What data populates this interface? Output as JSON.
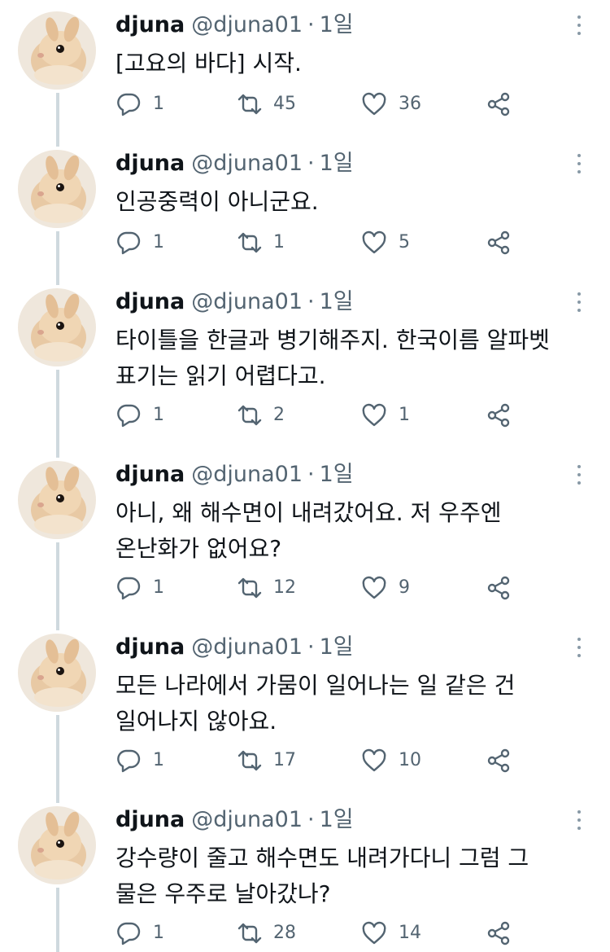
{
  "tweets": [
    {
      "name": "djuna",
      "handle": "@djuna01",
      "separator": "·",
      "time": "1일",
      "text": "[고요의 바다] 시작.",
      "replies": "1",
      "retweets": "45",
      "likes": "36"
    },
    {
      "name": "djuna",
      "handle": "@djuna01",
      "separator": "·",
      "time": "1일",
      "text": "인공중력이 아니군요.",
      "replies": "1",
      "retweets": "1",
      "likes": "5"
    },
    {
      "name": "djuna",
      "handle": "@djuna01",
      "separator": "·",
      "time": "1일",
      "text": "타이틀을 한글과 병기해주지. 한국이름 알파벳\n표기는 읽기 어렵다고.",
      "replies": "1",
      "retweets": "2",
      "likes": "1"
    },
    {
      "name": "djuna",
      "handle": "@djuna01",
      "separator": "·",
      "time": "1일",
      "text": "아니, 왜 해수면이 내려갔어요. 저 우주엔\n온난화가 없어요?",
      "replies": "1",
      "retweets": "12",
      "likes": "9"
    },
    {
      "name": "djuna",
      "handle": "@djuna01",
      "separator": "·",
      "time": "1일",
      "text": "모든 나라에서 가뭄이 일어나는 일 같은 건\n일어나지 않아요.",
      "replies": "1",
      "retweets": "17",
      "likes": "10"
    },
    {
      "name": "djuna",
      "handle": "@djuna01",
      "separator": "·",
      "time": "1일",
      "text": "강수량이 줄고 해수면도 내려가다니 그럼 그\n물은 우주로 날아갔나?",
      "replies": "1",
      "retweets": "28",
      "likes": "14"
    }
  ],
  "icons": {
    "reply": "reply-icon",
    "retweet": "retweet-icon",
    "like": "like-icon",
    "share": "share-icon",
    "more": "more-options-icon",
    "avatar": "rabbit-avatar"
  },
  "colors": {
    "name": "#0f1419",
    "meta": "#536471",
    "icon": "#536471",
    "thread_line": "#cfd9de"
  }
}
